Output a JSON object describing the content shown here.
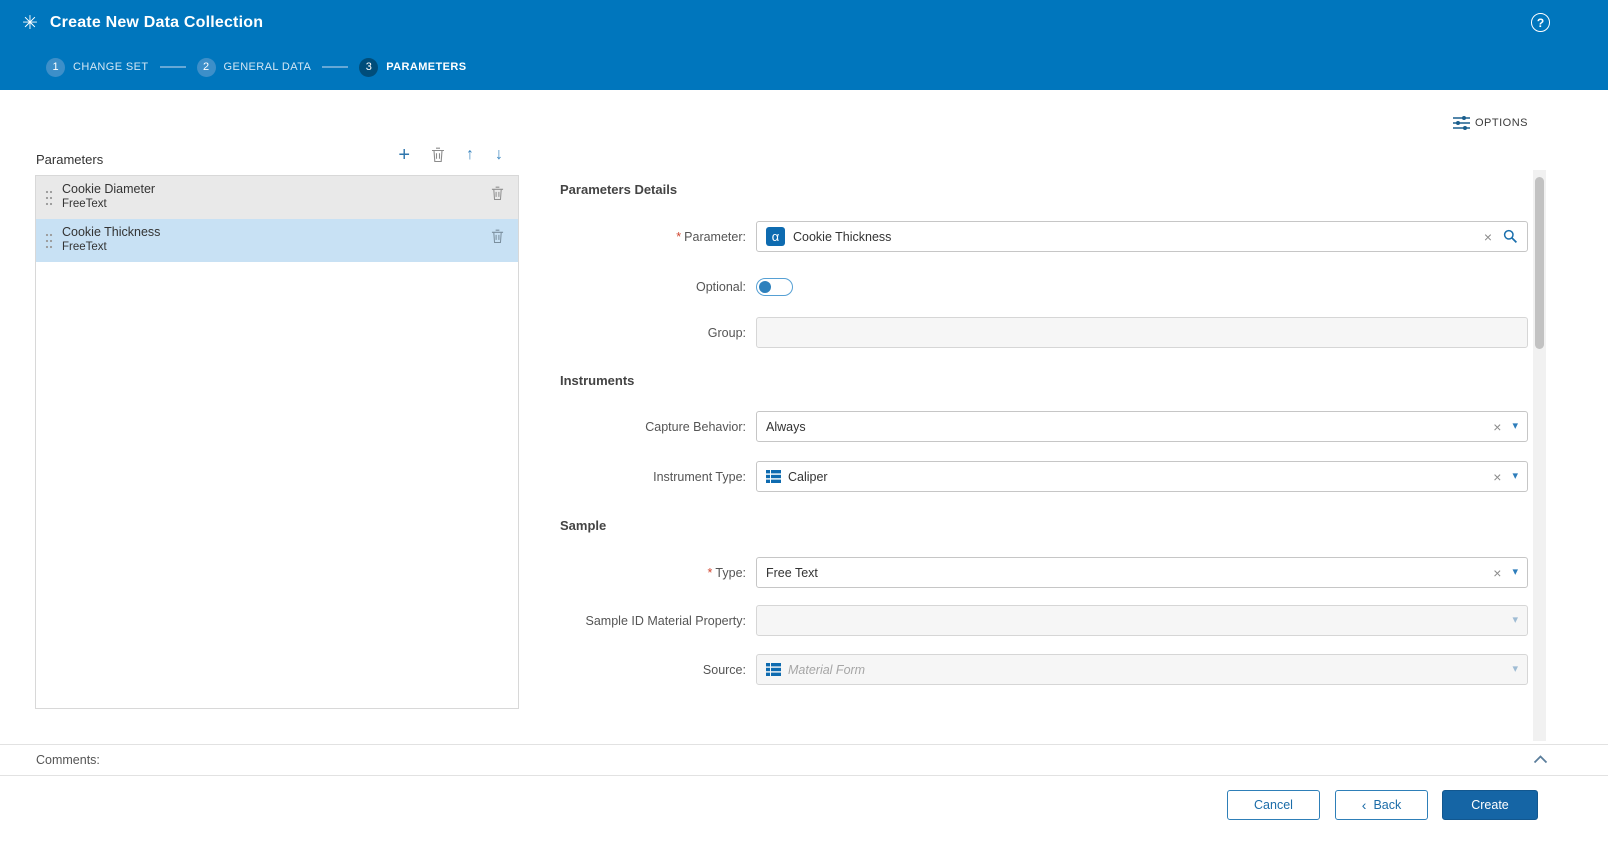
{
  "glyphs": {
    "caret": "▾",
    "clear": "×",
    "plus": "+",
    "arrow_up": "↑",
    "arrow_down": "↓",
    "alpha": "α",
    "back_chevron": "‹",
    "asterisk": "*"
  },
  "header": {
    "title": "Create New Data Collection",
    "logo_glyph": "✳",
    "help_glyph": "?"
  },
  "steps": [
    {
      "number": "1",
      "label": "CHANGE SET"
    },
    {
      "number": "2",
      "label": "GENERAL DATA"
    },
    {
      "number": "3",
      "label": "PARAMETERS"
    }
  ],
  "toolbar": {
    "options_label": "OPTIONS"
  },
  "parameters_panel": {
    "title": "Parameters",
    "items": [
      {
        "name": "Cookie Diameter",
        "type": "FreeText"
      },
      {
        "name": "Cookie Thickness",
        "type": "FreeText"
      }
    ]
  },
  "form": {
    "details_heading": "Parameters Details",
    "instruments_heading": "Instruments",
    "sample_heading": "Sample",
    "parameter": {
      "label": "Parameter:",
      "value": "Cookie Thickness"
    },
    "optional": {
      "label": "Optional:",
      "state": "off"
    },
    "group": {
      "label": "Group:",
      "value": ""
    },
    "capture_behavior": {
      "label": "Capture Behavior:",
      "value": "Always"
    },
    "instrument_type": {
      "label": "Instrument Type:",
      "value": "Caliper"
    },
    "sample_type": {
      "label": "Type:",
      "value": "Free Text"
    },
    "sample_id": {
      "label": "Sample ID Material Property:",
      "value": ""
    },
    "source": {
      "label": "Source:",
      "placeholder": "Material Form"
    }
  },
  "comments": {
    "label": "Comments:"
  },
  "footer": {
    "cancel": "Cancel",
    "back": "Back",
    "create": "Create"
  }
}
